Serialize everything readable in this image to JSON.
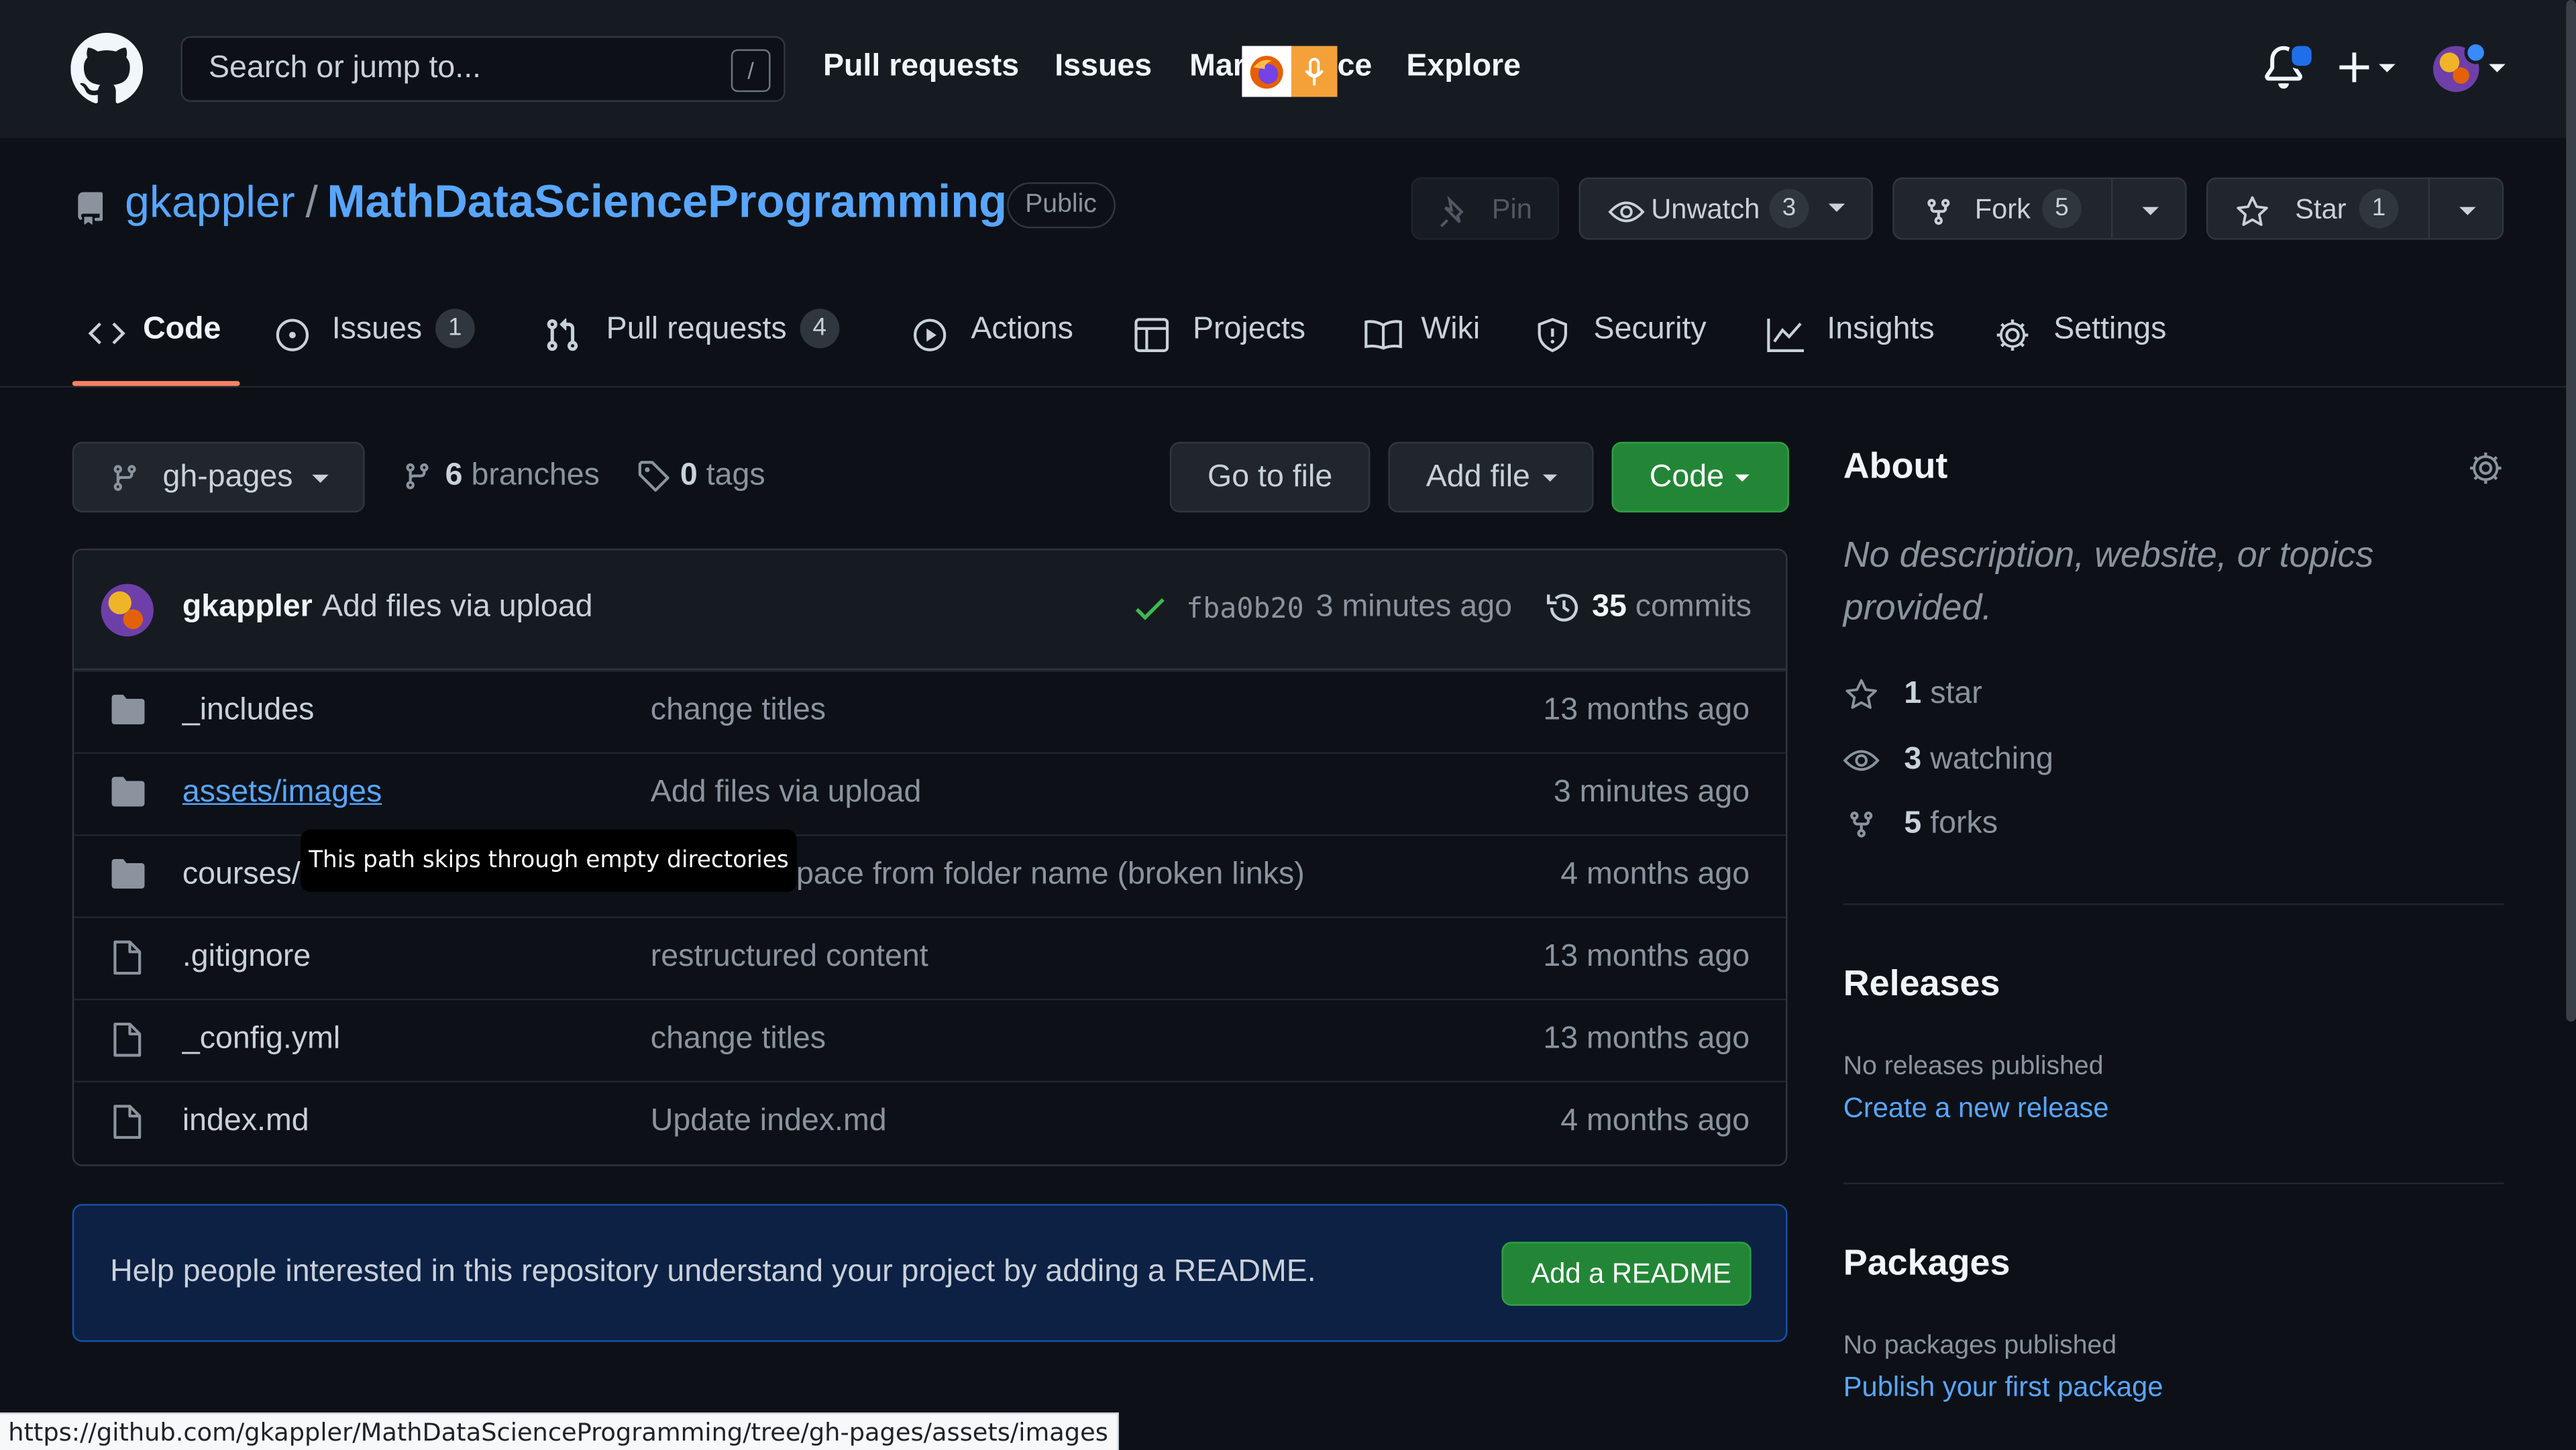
{
  "header": {
    "search_placeholder": "Search or jump to...",
    "search_shortcut": "/",
    "nav": [
      "Pull requests",
      "Issues",
      "Mar",
      "ce",
      "Explore"
    ]
  },
  "repo": {
    "owner": "gkappler",
    "separator": "/",
    "name": "MathDataScienceProgramming",
    "visibility": "Public",
    "pin_label": "Pin",
    "unwatch_label": "Unwatch",
    "watch_count": "3",
    "fork_label": "Fork",
    "fork_count": "5",
    "star_label": "Star",
    "star_count": "1"
  },
  "tabs": [
    {
      "label": "Code"
    },
    {
      "label": "Issues",
      "count": "1"
    },
    {
      "label": "Pull requests",
      "count": "4"
    },
    {
      "label": "Actions"
    },
    {
      "label": "Projects"
    },
    {
      "label": "Wiki"
    },
    {
      "label": "Security"
    },
    {
      "label": "Insights"
    },
    {
      "label": "Settings"
    }
  ],
  "toolbar": {
    "branch": "gh-pages",
    "branches_count": "6",
    "branches_label": "branches",
    "tags_count": "0",
    "tags_label": "tags",
    "go_to_file": "Go to file",
    "add_file": "Add file",
    "code": "Code"
  },
  "commit": {
    "author": "gkappler",
    "message": "Add files via upload",
    "sha": "fba0b20",
    "age": "3 minutes ago",
    "commits_count": "35",
    "commits_label": "commits"
  },
  "files": [
    {
      "type": "dir",
      "name": "_includes",
      "message": "change titles",
      "age": "13 months ago"
    },
    {
      "type": "dir",
      "name": "assets/images",
      "message": "Add files via upload",
      "age": "3 minutes ago"
    },
    {
      "type": "dir",
      "name": "courses/curriculum",
      "message": "removed space from folder name (broken links)",
      "age": "4 months ago"
    },
    {
      "type": "file",
      "name": ".gitignore",
      "message": "restructured content",
      "age": "13 months ago"
    },
    {
      "type": "file",
      "name": "_config.yml",
      "message": "change titles",
      "age": "13 months ago"
    },
    {
      "type": "file",
      "name": "index.md",
      "message": "Update index.md",
      "age": "4 months ago"
    }
  ],
  "tooltip": "This path skips through empty directories",
  "readme": {
    "text": "Help people interested in this repository understand your project by adding a README.",
    "button": "Add a README"
  },
  "about": {
    "title": "About",
    "description": "No description, website, or topics provided.",
    "stars_count": "1",
    "stars_label": "star",
    "watching_count": "3",
    "watching_label": "watching",
    "forks_count": "5",
    "forks_label": "forks"
  },
  "releases": {
    "title": "Releases",
    "none": "No releases published",
    "link": "Create a new release"
  },
  "packages": {
    "title": "Packages",
    "none": "No packages published",
    "link": "Publish your first package"
  },
  "status_url": "https://github.com/gkappler/MathDataScienceProgramming/tree/gh-pages/assets/images",
  "colors": {
    "accent_link": "#58a6ff",
    "primary_button": "#238636",
    "tab_underline": "#f78166",
    "notification_dot": "#1f6feb"
  }
}
